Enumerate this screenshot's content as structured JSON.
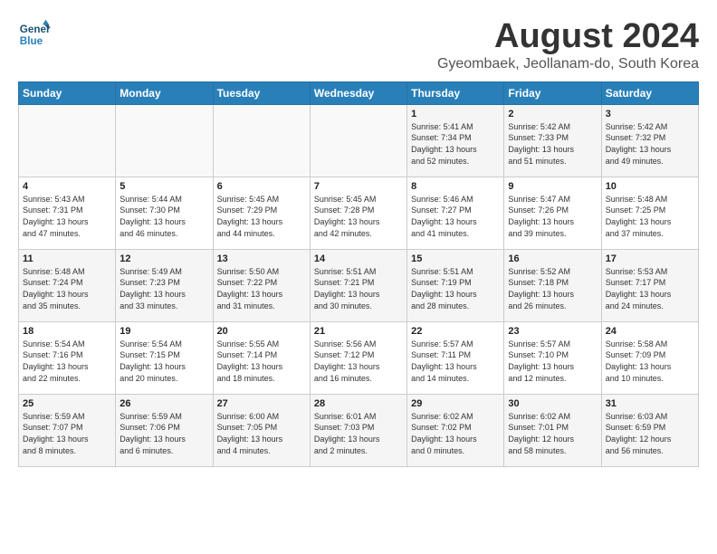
{
  "header": {
    "logo_line1": "General",
    "logo_line2": "Blue",
    "main_title": "August 2024",
    "subtitle": "Gyeombaek, Jeollanam-do, South Korea"
  },
  "calendar": {
    "weekdays": [
      "Sunday",
      "Monday",
      "Tuesday",
      "Wednesday",
      "Thursday",
      "Friday",
      "Saturday"
    ],
    "weeks": [
      [
        {
          "day": "",
          "detail": ""
        },
        {
          "day": "",
          "detail": ""
        },
        {
          "day": "",
          "detail": ""
        },
        {
          "day": "",
          "detail": ""
        },
        {
          "day": "1",
          "detail": "Sunrise: 5:41 AM\nSunset: 7:34 PM\nDaylight: 13 hours\nand 52 minutes."
        },
        {
          "day": "2",
          "detail": "Sunrise: 5:42 AM\nSunset: 7:33 PM\nDaylight: 13 hours\nand 51 minutes."
        },
        {
          "day": "3",
          "detail": "Sunrise: 5:42 AM\nSunset: 7:32 PM\nDaylight: 13 hours\nand 49 minutes."
        }
      ],
      [
        {
          "day": "4",
          "detail": "Sunrise: 5:43 AM\nSunset: 7:31 PM\nDaylight: 13 hours\nand 47 minutes."
        },
        {
          "day": "5",
          "detail": "Sunrise: 5:44 AM\nSunset: 7:30 PM\nDaylight: 13 hours\nand 46 minutes."
        },
        {
          "day": "6",
          "detail": "Sunrise: 5:45 AM\nSunset: 7:29 PM\nDaylight: 13 hours\nand 44 minutes."
        },
        {
          "day": "7",
          "detail": "Sunrise: 5:45 AM\nSunset: 7:28 PM\nDaylight: 13 hours\nand 42 minutes."
        },
        {
          "day": "8",
          "detail": "Sunrise: 5:46 AM\nSunset: 7:27 PM\nDaylight: 13 hours\nand 41 minutes."
        },
        {
          "day": "9",
          "detail": "Sunrise: 5:47 AM\nSunset: 7:26 PM\nDaylight: 13 hours\nand 39 minutes."
        },
        {
          "day": "10",
          "detail": "Sunrise: 5:48 AM\nSunset: 7:25 PM\nDaylight: 13 hours\nand 37 minutes."
        }
      ],
      [
        {
          "day": "11",
          "detail": "Sunrise: 5:48 AM\nSunset: 7:24 PM\nDaylight: 13 hours\nand 35 minutes."
        },
        {
          "day": "12",
          "detail": "Sunrise: 5:49 AM\nSunset: 7:23 PM\nDaylight: 13 hours\nand 33 minutes."
        },
        {
          "day": "13",
          "detail": "Sunrise: 5:50 AM\nSunset: 7:22 PM\nDaylight: 13 hours\nand 31 minutes."
        },
        {
          "day": "14",
          "detail": "Sunrise: 5:51 AM\nSunset: 7:21 PM\nDaylight: 13 hours\nand 30 minutes."
        },
        {
          "day": "15",
          "detail": "Sunrise: 5:51 AM\nSunset: 7:19 PM\nDaylight: 13 hours\nand 28 minutes."
        },
        {
          "day": "16",
          "detail": "Sunrise: 5:52 AM\nSunset: 7:18 PM\nDaylight: 13 hours\nand 26 minutes."
        },
        {
          "day": "17",
          "detail": "Sunrise: 5:53 AM\nSunset: 7:17 PM\nDaylight: 13 hours\nand 24 minutes."
        }
      ],
      [
        {
          "day": "18",
          "detail": "Sunrise: 5:54 AM\nSunset: 7:16 PM\nDaylight: 13 hours\nand 22 minutes."
        },
        {
          "day": "19",
          "detail": "Sunrise: 5:54 AM\nSunset: 7:15 PM\nDaylight: 13 hours\nand 20 minutes."
        },
        {
          "day": "20",
          "detail": "Sunrise: 5:55 AM\nSunset: 7:14 PM\nDaylight: 13 hours\nand 18 minutes."
        },
        {
          "day": "21",
          "detail": "Sunrise: 5:56 AM\nSunset: 7:12 PM\nDaylight: 13 hours\nand 16 minutes."
        },
        {
          "day": "22",
          "detail": "Sunrise: 5:57 AM\nSunset: 7:11 PM\nDaylight: 13 hours\nand 14 minutes."
        },
        {
          "day": "23",
          "detail": "Sunrise: 5:57 AM\nSunset: 7:10 PM\nDaylight: 13 hours\nand 12 minutes."
        },
        {
          "day": "24",
          "detail": "Sunrise: 5:58 AM\nSunset: 7:09 PM\nDaylight: 13 hours\nand 10 minutes."
        }
      ],
      [
        {
          "day": "25",
          "detail": "Sunrise: 5:59 AM\nSunset: 7:07 PM\nDaylight: 13 hours\nand 8 minutes."
        },
        {
          "day": "26",
          "detail": "Sunrise: 5:59 AM\nSunset: 7:06 PM\nDaylight: 13 hours\nand 6 minutes."
        },
        {
          "day": "27",
          "detail": "Sunrise: 6:00 AM\nSunset: 7:05 PM\nDaylight: 13 hours\nand 4 minutes."
        },
        {
          "day": "28",
          "detail": "Sunrise: 6:01 AM\nSunset: 7:03 PM\nDaylight: 13 hours\nand 2 minutes."
        },
        {
          "day": "29",
          "detail": "Sunrise: 6:02 AM\nSunset: 7:02 PM\nDaylight: 13 hours\nand 0 minutes."
        },
        {
          "day": "30",
          "detail": "Sunrise: 6:02 AM\nSunset: 7:01 PM\nDaylight: 12 hours\nand 58 minutes."
        },
        {
          "day": "31",
          "detail": "Sunrise: 6:03 AM\nSunset: 6:59 PM\nDaylight: 12 hours\nand 56 minutes."
        }
      ]
    ]
  }
}
